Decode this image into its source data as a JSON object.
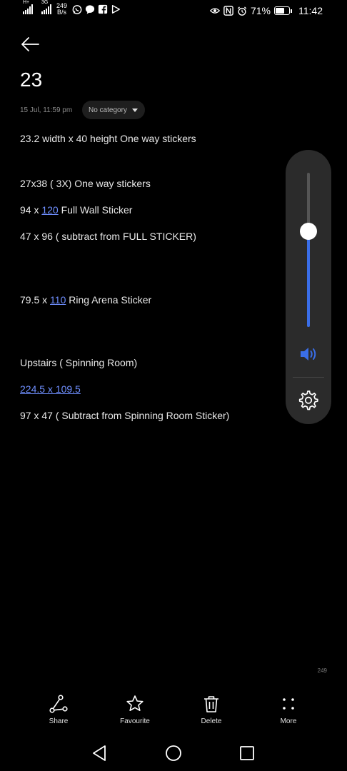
{
  "status_bar": {
    "network_left": "H+",
    "network_right": "3G",
    "speed_value": "249",
    "speed_unit": "B/s",
    "battery_percent": "71%",
    "battery_level": 0.71,
    "time": "11:42",
    "app_icons": [
      "whatsapp-icon",
      "chat-bubble-icon",
      "facebook-icon",
      "play-icon"
    ],
    "right_icons": [
      "eye-icon",
      "nfc-icon",
      "alarm-icon"
    ]
  },
  "note": {
    "title": "23",
    "date": "15 Jul, 11:59 pm",
    "category": "No category",
    "char_count": "249",
    "lines": [
      {
        "pre": "23.2 width x 40 height One way stickers",
        "link": "",
        "post": ""
      },
      {
        "pre": "27x38 ( 3X) One way stickers",
        "link": "",
        "post": ""
      },
      {
        "pre": "94 x ",
        "link": "120",
        "post": " Full Wall Sticker"
      },
      {
        "pre": "47 x  96 ( subtract from FULL STICKER)",
        "link": "",
        "post": ""
      },
      {
        "pre": "79.5 x ",
        "link": "110",
        "post": " Ring Arena Sticker"
      },
      {
        "pre": "Upstairs ( Spinning Room)",
        "link": "",
        "post": ""
      },
      {
        "pre": "",
        "link": "224.5 x 109.5",
        "post": ""
      },
      {
        "pre": "97 x 47 ( Subtract from Spinning Room Sticker)",
        "link": "",
        "post": ""
      }
    ]
  },
  "volume": {
    "level": 0.62,
    "accent": "#3a6ee8"
  },
  "toolbar": {
    "share_label": "Share",
    "favourite_label": "Favourite",
    "delete_label": "Delete",
    "more_label": "More"
  },
  "navbar": {
    "back": "back-icon",
    "home": "home-icon",
    "recents": "recents-icon"
  }
}
